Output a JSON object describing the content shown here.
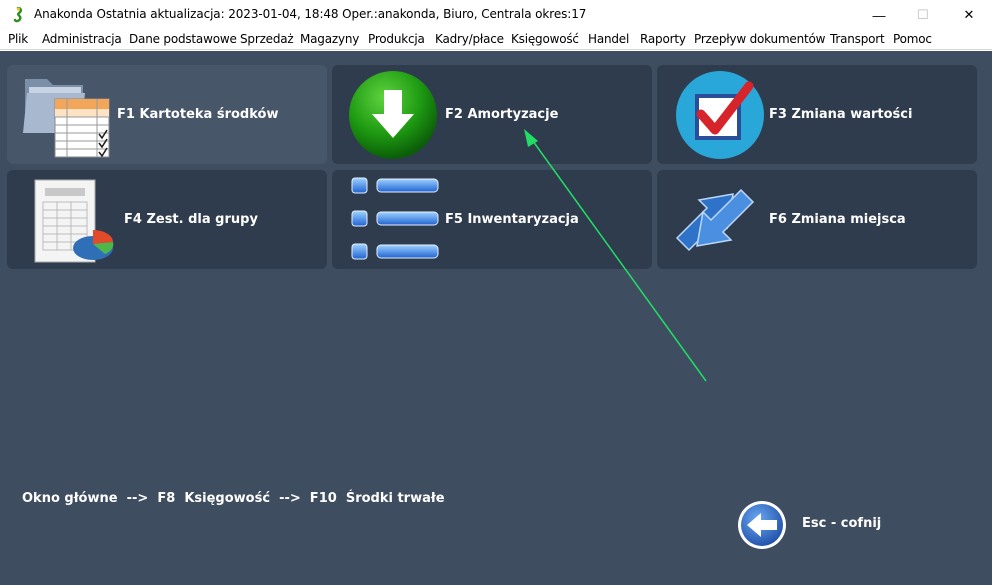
{
  "window": {
    "title": "Anakonda Ostatnia aktualizacja: 2023-01-04, 18:48 Oper.:anakonda, Biuro, Centrala   okres:17",
    "minimize": "—",
    "maximize": "☐",
    "close": "✕"
  },
  "menu": [
    {
      "label": "Plik"
    },
    {
      "label": "Administracja"
    },
    {
      "label": "Dane podstawowe"
    },
    {
      "label": "Sprzedaż"
    },
    {
      "label": "Magazyny"
    },
    {
      "label": "Produkcja"
    },
    {
      "label": "Kadry/płace"
    },
    {
      "label": "Księgowość"
    },
    {
      "label": "Handel"
    },
    {
      "label": "Raporty"
    },
    {
      "label": "Przepływ dokumentów"
    },
    {
      "label": "Transport"
    },
    {
      "label": "Pomoc"
    }
  ],
  "tiles": [
    {
      "label": "F1  Kartoteka środków",
      "icon": "folder-table-icon"
    },
    {
      "label": "F2  Amortyzacje",
      "icon": "down-arrow-circle-icon"
    },
    {
      "label": "F3  Zmiana wartości",
      "icon": "checkbox-check-icon"
    },
    {
      "label": "F4  Zest. dla grupy",
      "icon": "sheet-pie-chart-icon"
    },
    {
      "label": "F5  Inwentaryzacja",
      "icon": "list-bullets-icon"
    },
    {
      "label": "F6  Zmiana miejsca",
      "icon": "swap-arrows-icon"
    }
  ],
  "breadcrumb": "Okno główne  -->  F8  Księgowość  -->  F10  Środki trwałe",
  "esc": {
    "label": "Esc - cofnij",
    "icon": "back-arrow-icon"
  },
  "colors": {
    "background": "#3f4d60",
    "tile": "#2f3c4d",
    "tile_active": "#485669",
    "annotation": "#22dd66"
  }
}
